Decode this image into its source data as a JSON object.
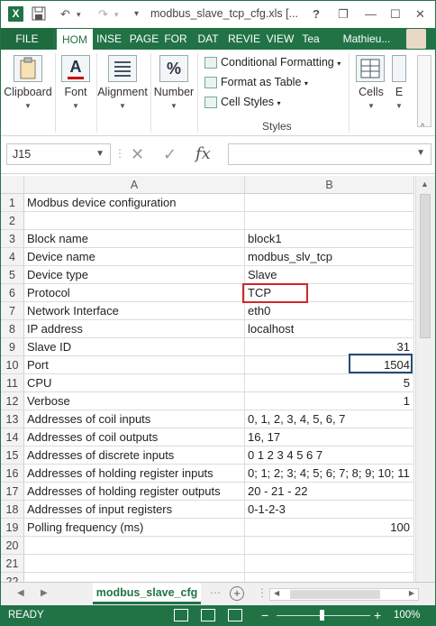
{
  "titlebar": {
    "title": "modbus_slave_tcp_cfg.xls  [...",
    "help": "?",
    "restore": "❐",
    "minimize": "—",
    "maximize": "☐",
    "close": "✕"
  },
  "tabs": {
    "file": "FILE",
    "home": "HOM",
    "insert": "INSE",
    "page": "PAGE",
    "formulas": "FOR",
    "data": "DAT",
    "review": "REVIE",
    "view": "VIEW",
    "team": "Tea",
    "user": "Mathieu..."
  },
  "ribbon": {
    "clipboard": "Clipboard",
    "font": "Font",
    "alignment": "Alignment",
    "number": "Number",
    "conditional_formatting": "Conditional Formatting",
    "format_as_table": "Format as Table",
    "cell_styles": "Cell Styles",
    "styles_group": "Styles",
    "cells": "Cells",
    "editing": "E"
  },
  "formula_bar": {
    "name_box": "J15",
    "fx": "fx",
    "value": ""
  },
  "columns": {
    "a": "A",
    "b": "B"
  },
  "rows": [
    {
      "n": "1",
      "a": "Modbus device configuration",
      "b": ""
    },
    {
      "n": "2",
      "a": "",
      "b": ""
    },
    {
      "n": "3",
      "a": "Block name",
      "b": "block1"
    },
    {
      "n": "4",
      "a": "Device name",
      "b": "modbus_slv_tcp"
    },
    {
      "n": "5",
      "a": "Device type",
      "b": "Slave"
    },
    {
      "n": "6",
      "a": "Protocol",
      "b": "TCP"
    },
    {
      "n": "7",
      "a": "Network Interface",
      "b": "eth0"
    },
    {
      "n": "8",
      "a": "IP address",
      "b": "localhost"
    },
    {
      "n": "9",
      "a": "Slave ID",
      "b": "31"
    },
    {
      "n": "10",
      "a": "Port",
      "b": "1504"
    },
    {
      "n": "11",
      "a": "CPU",
      "b": "5"
    },
    {
      "n": "12",
      "a": "Verbose",
      "b": "1"
    },
    {
      "n": "13",
      "a": "Addresses of coil inputs",
      "b": "0, 1, 2, 3, 4, 5, 6, 7"
    },
    {
      "n": "14",
      "a": "Addresses of coil outputs",
      "b": "16, 17"
    },
    {
      "n": "15",
      "a": "Addresses of discrete inputs",
      "b": "0 1 2 3 4 5 6 7"
    },
    {
      "n": "16",
      "a": "Addresses of holding register inputs",
      "b": "0; 1; 2; 3; 4; 5; 6; 7; 8; 9; 10; 11"
    },
    {
      "n": "17",
      "a": "Addresses of holding register outputs",
      "b": "20 - 21 - 22"
    },
    {
      "n": "18",
      "a": "Addresses of input registers",
      "b": "0-1-2-3"
    },
    {
      "n": "19",
      "a": "Polling frequency (ms)",
      "b": "100"
    },
    {
      "n": "20",
      "a": "",
      "b": ""
    },
    {
      "n": "21",
      "a": "",
      "b": ""
    },
    {
      "n": "22",
      "a": "",
      "b": ""
    }
  ],
  "sheet_tabs": {
    "active": "modbus_slave_cfg",
    "add": "+"
  },
  "status": {
    "ready": "READY",
    "zoom_minus": "−",
    "zoom_plus": "+",
    "zoom": "100%"
  },
  "colors": {
    "excel_green": "#217346",
    "highlight_red": "#d02828",
    "highlight_blue": "#274a78"
  }
}
